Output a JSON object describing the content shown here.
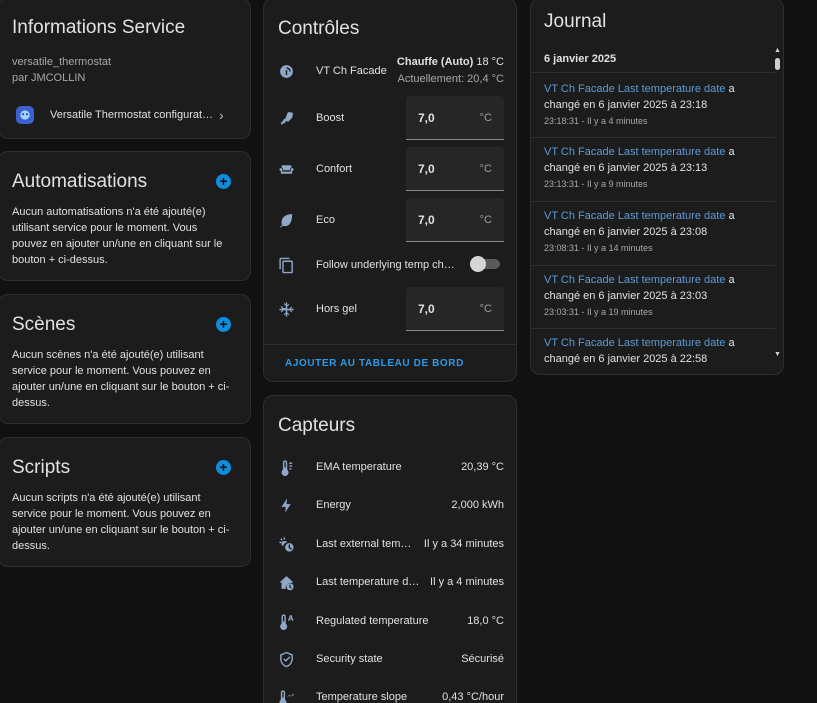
{
  "info": {
    "title": "Informations Service",
    "model": "versatile_thermostat",
    "manufacturer": "par JMCOLLIN",
    "integration_label": "Versatile Thermostat configurat…"
  },
  "automations": {
    "title": "Automatisations",
    "empty": "Aucun automatisations n'a été ajouté(e) utilisant service pour le moment. Vous pouvez en ajouter un/une en cliquant sur le bouton + ci-dessus."
  },
  "scenes": {
    "title": "Scènes",
    "empty": "Aucun scènes n'a été ajouté(e) utilisant service pour le moment. Vous pouvez en ajouter un/une en cliquant sur le bouton + ci-dessus."
  },
  "scripts": {
    "title": "Scripts",
    "empty": "Aucun scripts n'a été ajouté(e) utilisant service pour le moment. Vous pouvez en ajouter un/une en cliquant sur le bouton + ci-dessus."
  },
  "controls": {
    "title": "Contrôles",
    "climate_label": "VT Ch Facade",
    "climate_state": "Chauffe (Auto)",
    "climate_target": "18 °C",
    "climate_current": "Actuellement: 20,4 °C",
    "boost_label": "Boost",
    "boost_value": "7,0",
    "confort_label": "Confort",
    "confort_value": "7,0",
    "eco_label": "Eco",
    "eco_value": "7,0",
    "follow_label": "Follow underlying temp ch…",
    "hors_gel_label": "Hors gel",
    "hors_gel_value": "7,0",
    "unit": "°C",
    "add_dashboard": "AJOUTER AU TABLEAU DE BORD"
  },
  "sensors": {
    "title": "Capteurs",
    "items": [
      {
        "label": "EMA temperature",
        "value": "20,39 °C"
      },
      {
        "label": "Energy",
        "value": "2,000 kWh"
      },
      {
        "label": "Last external tem…",
        "value": "Il y a 34 minutes"
      },
      {
        "label": "Last temperature d…",
        "value": "Il y a 4 minutes"
      },
      {
        "label": "Regulated temperature",
        "value": "18,0 °C"
      },
      {
        "label": "Security state",
        "value": "Sécurisé"
      },
      {
        "label": "Temperature slope",
        "value": "0,43 °C/hour"
      }
    ]
  },
  "journal": {
    "title": "Journal",
    "date": "6 janvier 2025",
    "entries": [
      {
        "link": "VT Ch Facade Last temperature date",
        "conj": "a",
        "text": "changé en 6 janvier 2025 à 23:18",
        "time": "23:18:31 - Il y a 4 minutes"
      },
      {
        "link": "VT Ch Facade Last temperature date",
        "conj": "a",
        "text": "changé en 6 janvier 2025 à 23:13",
        "time": "23:13:31 - Il y a 9 minutes"
      },
      {
        "link": "VT Ch Facade Last temperature date",
        "conj": "a",
        "text": "changé en 6 janvier 2025 à 23:08",
        "time": "23:08:31 - Il y a 14 minutes"
      },
      {
        "link": "VT Ch Facade Last temperature date",
        "conj": "a",
        "text": "changé en 6 janvier 2025 à 23:03",
        "time": "23:03:31 - Il y a 19 minutes"
      },
      {
        "link": "VT Ch Facade Last temperature date",
        "conj": "a",
        "text": "changé en 6 janvier 2025 à 22:58",
        "time": ""
      }
    ]
  },
  "colors": {
    "accent": "#0d8de0",
    "link": "#5b9bd5",
    "icon": "#8fa8c8",
    "card": "#1c1c1c"
  }
}
